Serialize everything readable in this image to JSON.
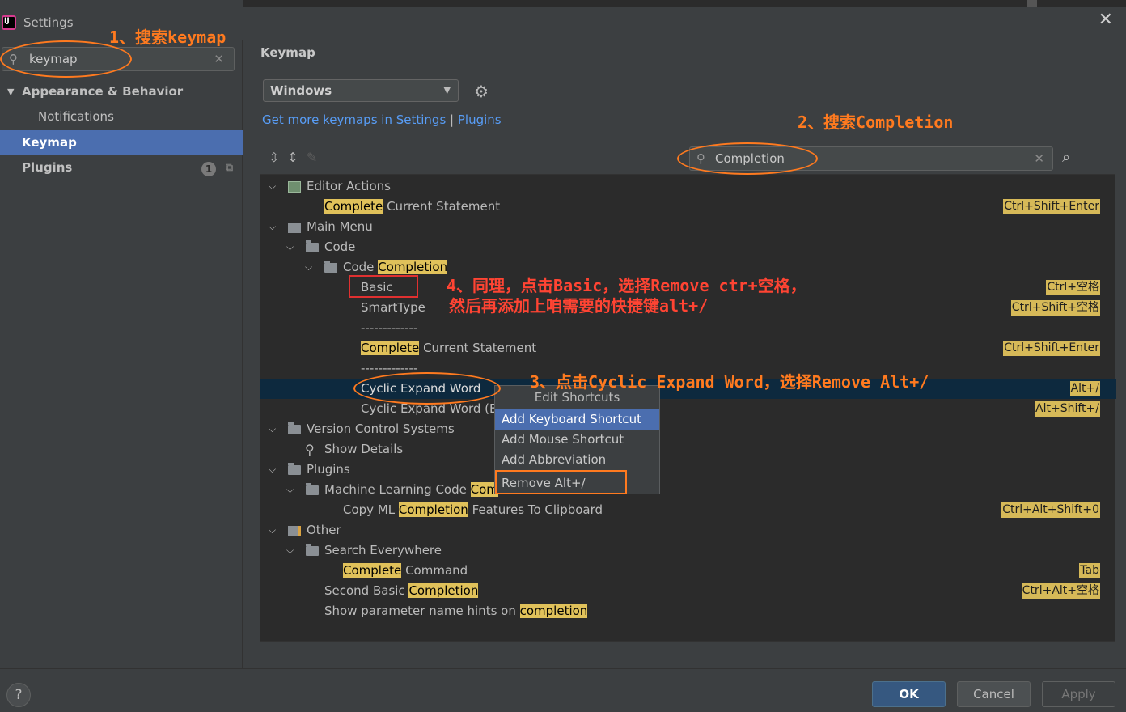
{
  "window": {
    "title": "Settings",
    "close": "✕"
  },
  "sidebar": {
    "search_value": "keymap",
    "items": [
      {
        "label": "Appearance & Behavior"
      },
      {
        "label": "Notifications"
      },
      {
        "label": "Keymap"
      },
      {
        "label": "Plugins",
        "badge": "1"
      }
    ]
  },
  "main": {
    "heading": "Keymap",
    "keymap_selected": "Windows",
    "link_more": "Get more keymaps in Settings",
    "link_sep": "|",
    "link_plugins": "Plugins",
    "filter_value": "Completion"
  },
  "tree": {
    "editor_actions": "Editor Actions",
    "complete_current": {
      "hl": "Complete",
      "rest": " Current Statement",
      "shortcut": "Ctrl+Shift+Enter"
    },
    "main_menu": "Main Menu",
    "code": "Code",
    "code_completion": {
      "pre": "Code ",
      "hl": "Completion"
    },
    "basic": {
      "label": "Basic",
      "shortcut": "Ctrl+空格"
    },
    "smarttype": {
      "label": "SmartType",
      "shortcut": "Ctrl+Shift+空格"
    },
    "separator": "-------------",
    "complete_current2": {
      "hl": "Complete",
      "rest": " Current Statement",
      "shortcut": "Ctrl+Shift+Enter"
    },
    "cyclic_expand": {
      "label": "Cyclic Expand Word",
      "shortcut": "Alt+/"
    },
    "cyclic_expand_back": {
      "label": "Cyclic Expand Word (Ba",
      "shortcut": "Alt+Shift+/"
    },
    "vcs": "Version Control Systems",
    "show_details": "Show Details",
    "plugins": "Plugins",
    "ml_code": {
      "pre": "Machine Learning Code ",
      "hl": "Com"
    },
    "copy_ml": {
      "pre": "Copy ML ",
      "hl": "Completion",
      "rest": " Features To Clipboard",
      "shortcut": "Ctrl+Alt+Shift+0"
    },
    "other": "Other",
    "search_everywhere": "Search Everywhere",
    "complete_command": {
      "hl": "Complete",
      "rest": " Command",
      "shortcut": "Tab"
    },
    "second_basic": {
      "pre": "Second Basic ",
      "hl": "Completion",
      "shortcut": "Ctrl+Alt+空格"
    },
    "param_hints": {
      "pre": "Show parameter name hints on ",
      "hl": "completion"
    }
  },
  "context_menu": {
    "header": "Edit Shortcuts",
    "items": [
      "Add Keyboard Shortcut",
      "Add Mouse Shortcut",
      "Add Abbreviation",
      "Remove Alt+/"
    ]
  },
  "annotations": {
    "step1": "1、搜索keymap",
    "step2": "2、搜索Completion",
    "step3": "3、点击Cyclic Expand Word，选择Remove Alt+/",
    "step4_line1": "4、同理，点击Basic，选择Remove ctr+空格，",
    "step4_line2": "然后再添加上咱需要的快捷键alt+/"
  },
  "footer": {
    "help": "?",
    "ok": "OK",
    "cancel": "Cancel",
    "apply": "Apply"
  },
  "icons": {
    "search": "search-icon",
    "clear": "clear-icon",
    "gear": "gear-icon",
    "expand_all": "expand-all-icon",
    "collapse_all": "collapse-all-icon",
    "edit": "pencil-icon",
    "find_shortcut": "find-by-shortcut-icon"
  }
}
